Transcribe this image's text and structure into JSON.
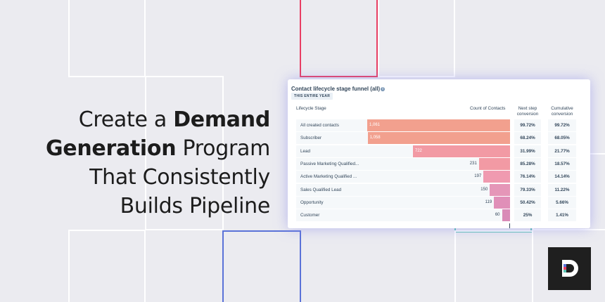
{
  "headline": {
    "line1_pre": "Create a ",
    "line1_bold": "Demand",
    "line2_bold": "Generation",
    "line2_post": " Program",
    "line3": "That Consistently",
    "line4": "Builds Pipeline"
  },
  "card": {
    "title": "Contact lifecycle stage funnel (all)",
    "info_icon": "i",
    "badge": "THIS ENTIRE YEAR",
    "headers": {
      "stage": "Lifecycle Stage",
      "count": "Count of Contacts",
      "next_step_line1": "Next step",
      "next_step_line2": "conversion",
      "cumulative_line1": "Cumulative",
      "cumulative_line2": "conversion"
    }
  },
  "chart_data": {
    "type": "bar",
    "categories": [
      "All created contacts",
      "Subscriber",
      "Lead",
      "Passive Marketing Qualified...",
      "Active Marketing Qualified ...",
      "Sales Qualified Lead",
      "Opportunity",
      "Customer"
    ],
    "values": [
      1061,
      1058,
      722,
      231,
      197,
      150,
      119,
      60
    ],
    "value_labels": [
      "1,061",
      "1,058",
      "722",
      "231",
      "197",
      "150",
      "119",
      "60"
    ],
    "next_step_conversion": [
      "99.72%",
      "68.24%",
      "31.99%",
      "85.28%",
      "76.14%",
      "79.33%",
      "50.42%",
      "25%"
    ],
    "cumulative_conversion": [
      "99.72%",
      "68.05%",
      "21.77%",
      "18.57%",
      "14.14%",
      "11.22%",
      "5.66%",
      "1.41%"
    ],
    "colors": [
      "#f2a08e",
      "#f2a08e",
      "#f29aa4",
      "#f29aa4",
      "#f09ab0",
      "#e596b8",
      "#e08fb8",
      "#d98ab7"
    ]
  },
  "colors": {
    "background": "#ebebf0",
    "accent_pink": "#e83e63",
    "accent_blue": "#5a72d8",
    "accent_teal": "#5ec4b4",
    "logo_bg": "#1f1f1f"
  },
  "logo": {
    "letter": "D",
    "icon": "brand-logo-icon"
  }
}
